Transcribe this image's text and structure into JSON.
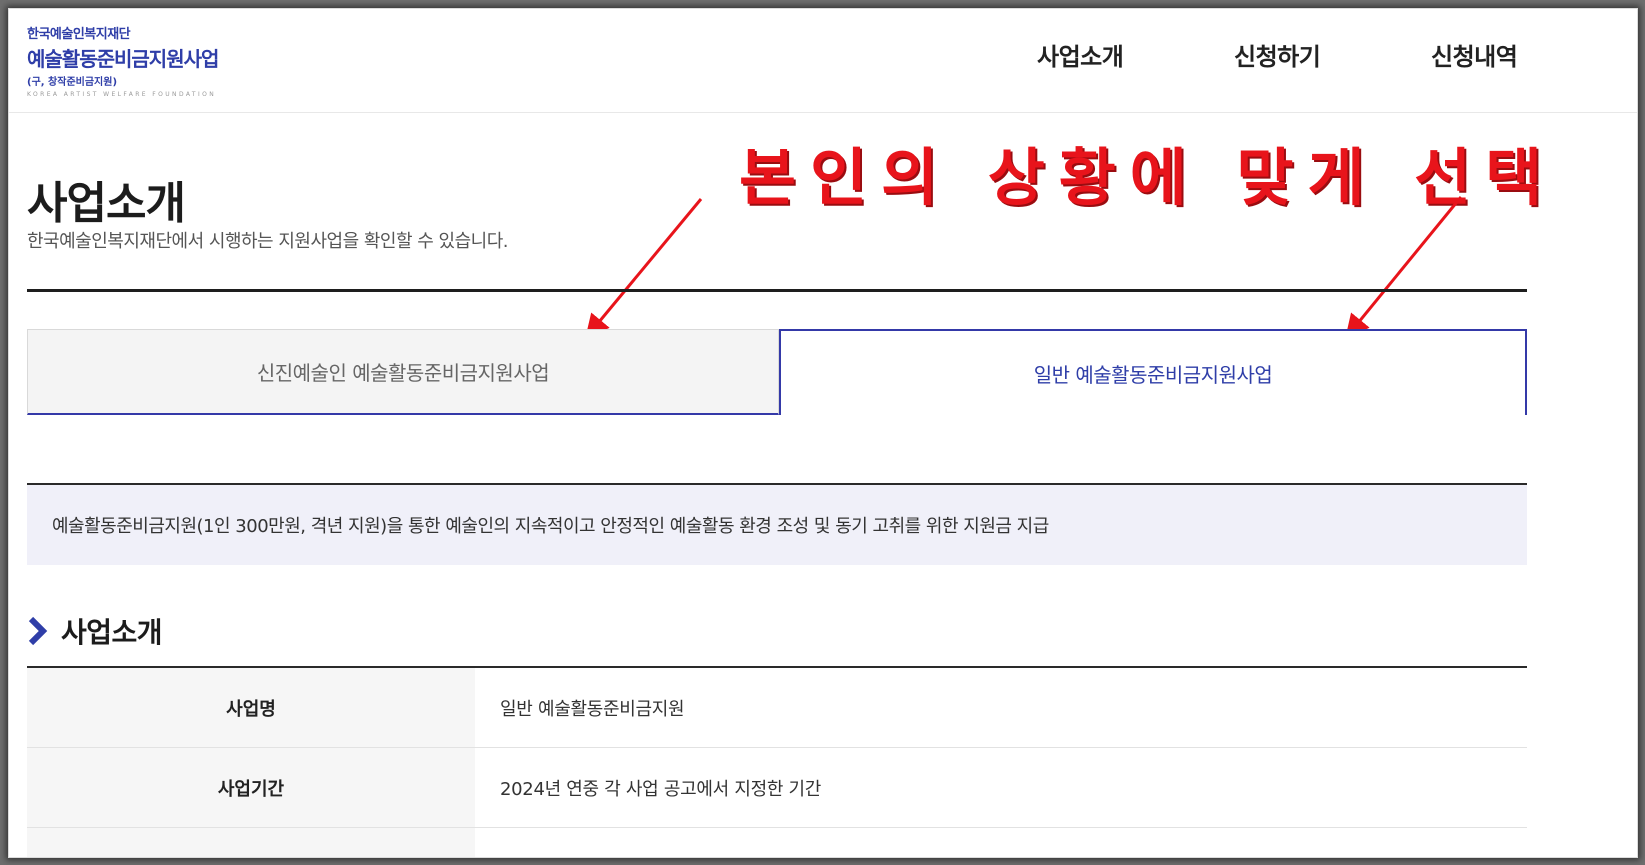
{
  "logo": {
    "line1": "한국예술인복지재단",
    "line2": "예술활동준비금지원사업",
    "line3": "(구, 창작준비금지원)",
    "line4": "KOREA ARTIST WELFARE FOUNDATION"
  },
  "nav": {
    "items": [
      "사업소개",
      "신청하기",
      "신청내역"
    ]
  },
  "annotation": "본인의 상황에 맞게 선택",
  "page": {
    "title": "사업소개",
    "subtitle": "한국예술인복지재단에서 시행하는 지원사업을 확인할 수 있습니다."
  },
  "tabs": [
    {
      "label": "신진예술인 예술활동준비금지원사업",
      "active": false
    },
    {
      "label": "일반 예술활동준비금지원사업",
      "active": true
    }
  ],
  "summary": "예술활동준비금지원(1인 300만원, 격년 지원)을 통한 예술인의 지속적이고 안정적인 예술활동 환경 조성 및 동기 고취를 위한 지원금 지급",
  "section": {
    "heading": "사업소개",
    "rows": [
      {
        "key": "사업명",
        "value": "일반 예술활동준비금지원"
      },
      {
        "key": "사업기간",
        "value": "2024년 연중 각 사업 공고에서 지정한 기간"
      },
      {
        "key": "",
        "value": ""
      }
    ]
  },
  "colors": {
    "brand": "#2f3ea8",
    "annotation": "#e8141b",
    "summary_bg": "#f0f0f9"
  }
}
